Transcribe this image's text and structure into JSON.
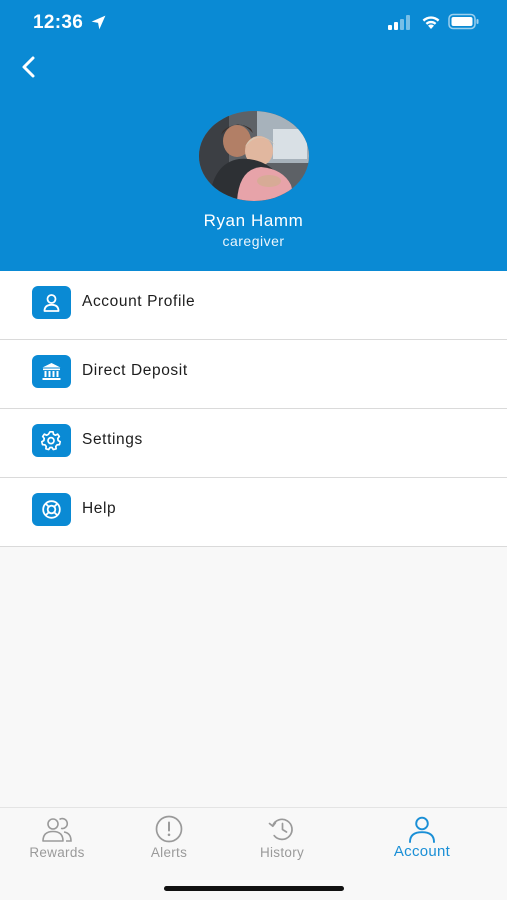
{
  "status_bar": {
    "time": "12:36"
  },
  "header": {
    "background_color": "#0a8ad4",
    "back_icon": "chevron-left-icon",
    "profile": {
      "name": "Ryan Hamm",
      "role": "caregiver"
    }
  },
  "menu": {
    "items": [
      {
        "label": "Account Profile",
        "icon": "user-icon"
      },
      {
        "label": "Direct Deposit",
        "icon": "bank-icon"
      },
      {
        "label": "Settings",
        "icon": "gear-icon"
      },
      {
        "label": "Help",
        "icon": "lifebuoy-icon"
      }
    ]
  },
  "tab_bar": {
    "tabs": [
      {
        "label": "Rewards",
        "icon": "users-icon",
        "active": false
      },
      {
        "label": "Alerts",
        "icon": "alert-circle-icon",
        "active": false
      },
      {
        "label": "History",
        "icon": "history-icon",
        "active": false
      },
      {
        "label": "Account",
        "icon": "user-icon",
        "active": true
      }
    ],
    "active_color": "#1a8fd6",
    "inactive_color": "#9a9a9a"
  }
}
